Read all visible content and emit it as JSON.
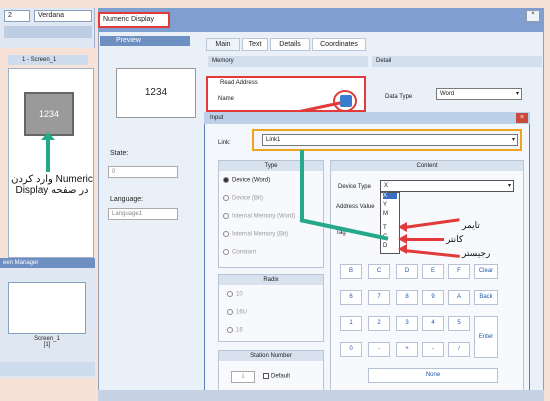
{
  "left": {
    "size_value": "2",
    "font_value": "Verdana",
    "screen_tab": "1 - Screen_1",
    "display_value": "1234",
    "annotation": "وارد کردن Numeric Display در صفحه",
    "screen_manager": "een Manager",
    "thumb_name": "Screen_1",
    "thumb_num": "[1]"
  },
  "dialog": {
    "title": "Numeric Display",
    "preview_label": "Preview",
    "preview_value": "1234",
    "tabs": [
      "Main",
      "Text",
      "Details",
      "Coordinates"
    ],
    "memory_label": "Memory",
    "detail_label": "Detail",
    "read_address_label": "Read Address",
    "name_label": "Name",
    "data_type_label": "Data Type",
    "data_type_value": "Word",
    "state_label": "State:",
    "state_value": "0",
    "language_label": "Language:",
    "language_value": "Language1"
  },
  "input": {
    "title": "Input",
    "link_label": "Link:",
    "link_value": "Link1",
    "type_header": "Type",
    "type_options": [
      "Device (Word)",
      "Device (Bit)",
      "Internal Memory (Word)",
      "Internal Memory (Bit)",
      "Constant"
    ],
    "radix_header": "Radix",
    "radix_options": [
      "10",
      "16U",
      "16"
    ],
    "station_header": "Station Number",
    "station_value": "1",
    "default_label": "Default",
    "content_header": "Content",
    "device_type_label": "Device Type",
    "device_type_value": "X",
    "dropdown_items": [
      "X",
      "Y",
      "M",
      "T",
      "C",
      "D"
    ],
    "address_label": "Address Value",
    "tag_label": "Tag",
    "keys": [
      "B",
      "C",
      "D",
      "E",
      "F",
      "Clear",
      "6",
      "7",
      "8",
      "9",
      "A",
      "Back",
      "1",
      "2",
      "3",
      "4",
      "5",
      "Enter",
      "0",
      "-",
      "+",
      "-",
      "/",
      "None"
    ],
    "annot_timer": "تایمر",
    "annot_counter": "کانتر",
    "annot_register": "رجیستر"
  }
}
